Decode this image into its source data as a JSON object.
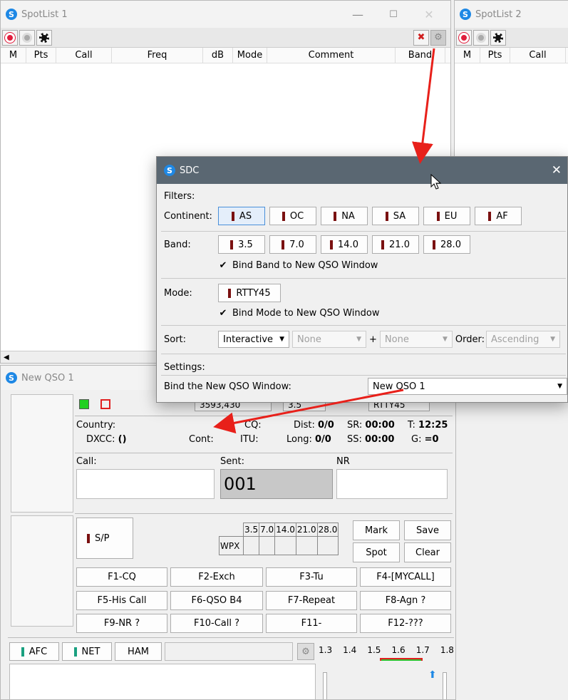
{
  "spotlist1": {
    "title": "SpotList 1",
    "columns": [
      "M",
      "Pts",
      "Call",
      "Freq",
      "dB",
      "Mode",
      "Comment",
      "Band"
    ]
  },
  "spotlist2": {
    "title": "SpotList 2",
    "columns": [
      "M",
      "Pts",
      "Call"
    ]
  },
  "sdc": {
    "title": "SDC",
    "filters_label": "Filters:",
    "continent_label": "Continent:",
    "continents": [
      "AS",
      "OC",
      "NA",
      "SA",
      "EU",
      "AF"
    ],
    "band_label": "Band:",
    "bands": [
      "3.5",
      "7.0",
      "14.0",
      "21.0",
      "28.0"
    ],
    "bind_band": "Bind Band to New QSO Window",
    "mode_label": "Mode:",
    "mode": "RTTY45",
    "bind_mode": "Bind Mode to New QSO Window",
    "sort_label": "Sort:",
    "sort_value": "Interactive",
    "sort2": "None",
    "plus": "+",
    "sort3": "None",
    "order_label": "Order:",
    "order_value": "Ascending",
    "settings_label": "Settings:",
    "bind_window_label": "Bind the New QSO Window:",
    "bind_window_value": "New QSO 1"
  },
  "qso": {
    "title": "New QSO 1",
    "freq": "3593,430",
    "band": "3.5",
    "mode": "RTTY45",
    "country_label": "Country:",
    "cq_label": "CQ:",
    "dist_label": "Dist:",
    "dist": "0/0",
    "sr_label": "SR:",
    "sr": "00:00",
    "t_label": "T:",
    "t": "12:25",
    "dxcc_label": "DXCC:",
    "dxcc": "()",
    "cont_label": "Cont:",
    "itu_label": "ITU:",
    "long_label": "Long:",
    "long": "0/0",
    "ss_label": "SS:",
    "ss": "00:00",
    "g_label": "G:",
    "g": "=0",
    "call_label": "Call:",
    "sent_label": "Sent:",
    "sent": "001",
    "nr_label": "NR",
    "sp": "S/P",
    "grid_bands": [
      "3.5",
      "7.0",
      "14.0",
      "21.0",
      "28.0"
    ],
    "wpx": "WPX",
    "mark": "Mark",
    "save": "Save",
    "spot": "Spot",
    "clear": "Clear",
    "fkeys": [
      "F1-CQ",
      "F2-Exch",
      "F3-Tu",
      "F4-[MYCALL]",
      "F5-His Call",
      "F6-QSO B4",
      "F7-Repeat",
      "F8-Agn ?",
      "F9-NR ?",
      "F10-Call ?",
      "F11-",
      "F12-???"
    ],
    "afc": "AFC",
    "net": "NET",
    "ham": "HAM",
    "scale": [
      "1.3",
      "1.4",
      "1.5",
      "1.6",
      "1.7",
      "1.8"
    ]
  },
  "colors": {
    "accent": "#1e88e5",
    "arrow": "#e8201a",
    "dialog_bar": "#5a6772"
  }
}
